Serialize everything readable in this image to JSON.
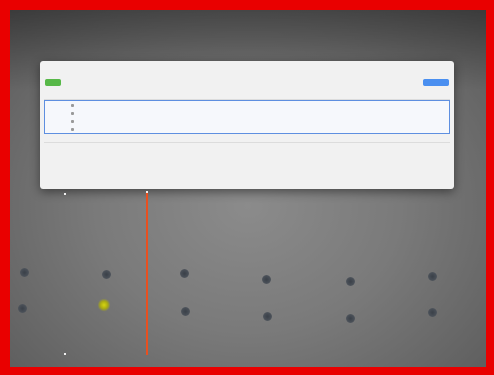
{
  "dialog": {
    "title": "",
    "toolbar_left": "",
    "toolbar_mid": "",
    "action_label": ""
  },
  "table": {
    "headers": [
      "",
      "",
      "",
      "",
      "",
      ""
    ],
    "selected_rows": [
      {
        "name": "",
        "count": ""
      },
      {
        "name": "",
        "count": ""
      },
      {
        "name": "",
        "count": ""
      },
      {
        "name": "",
        "count": ""
      }
    ],
    "subheaders": [
      "",
      "",
      "",
      "",
      ""
    ],
    "rows": [
      {
        "name": "",
        "a": "",
        "b": "",
        "c": "",
        "d": "",
        "e": ""
      },
      {
        "name": "",
        "a": "",
        "b": "",
        "c": "",
        "d": "",
        "e": ""
      },
      {
        "name": "",
        "a": "",
        "b": "",
        "c": "",
        "d": "",
        "e": ""
      },
      {
        "name": "",
        "a": "",
        "b": "",
        "c": "",
        "d": "",
        "e": ""
      }
    ]
  },
  "colors": {
    "frame": "#e90000",
    "scan_line": "#e85020",
    "highlight": "#e6e600",
    "primary_button": "#4a8ff0",
    "success_button": "#57b848"
  }
}
